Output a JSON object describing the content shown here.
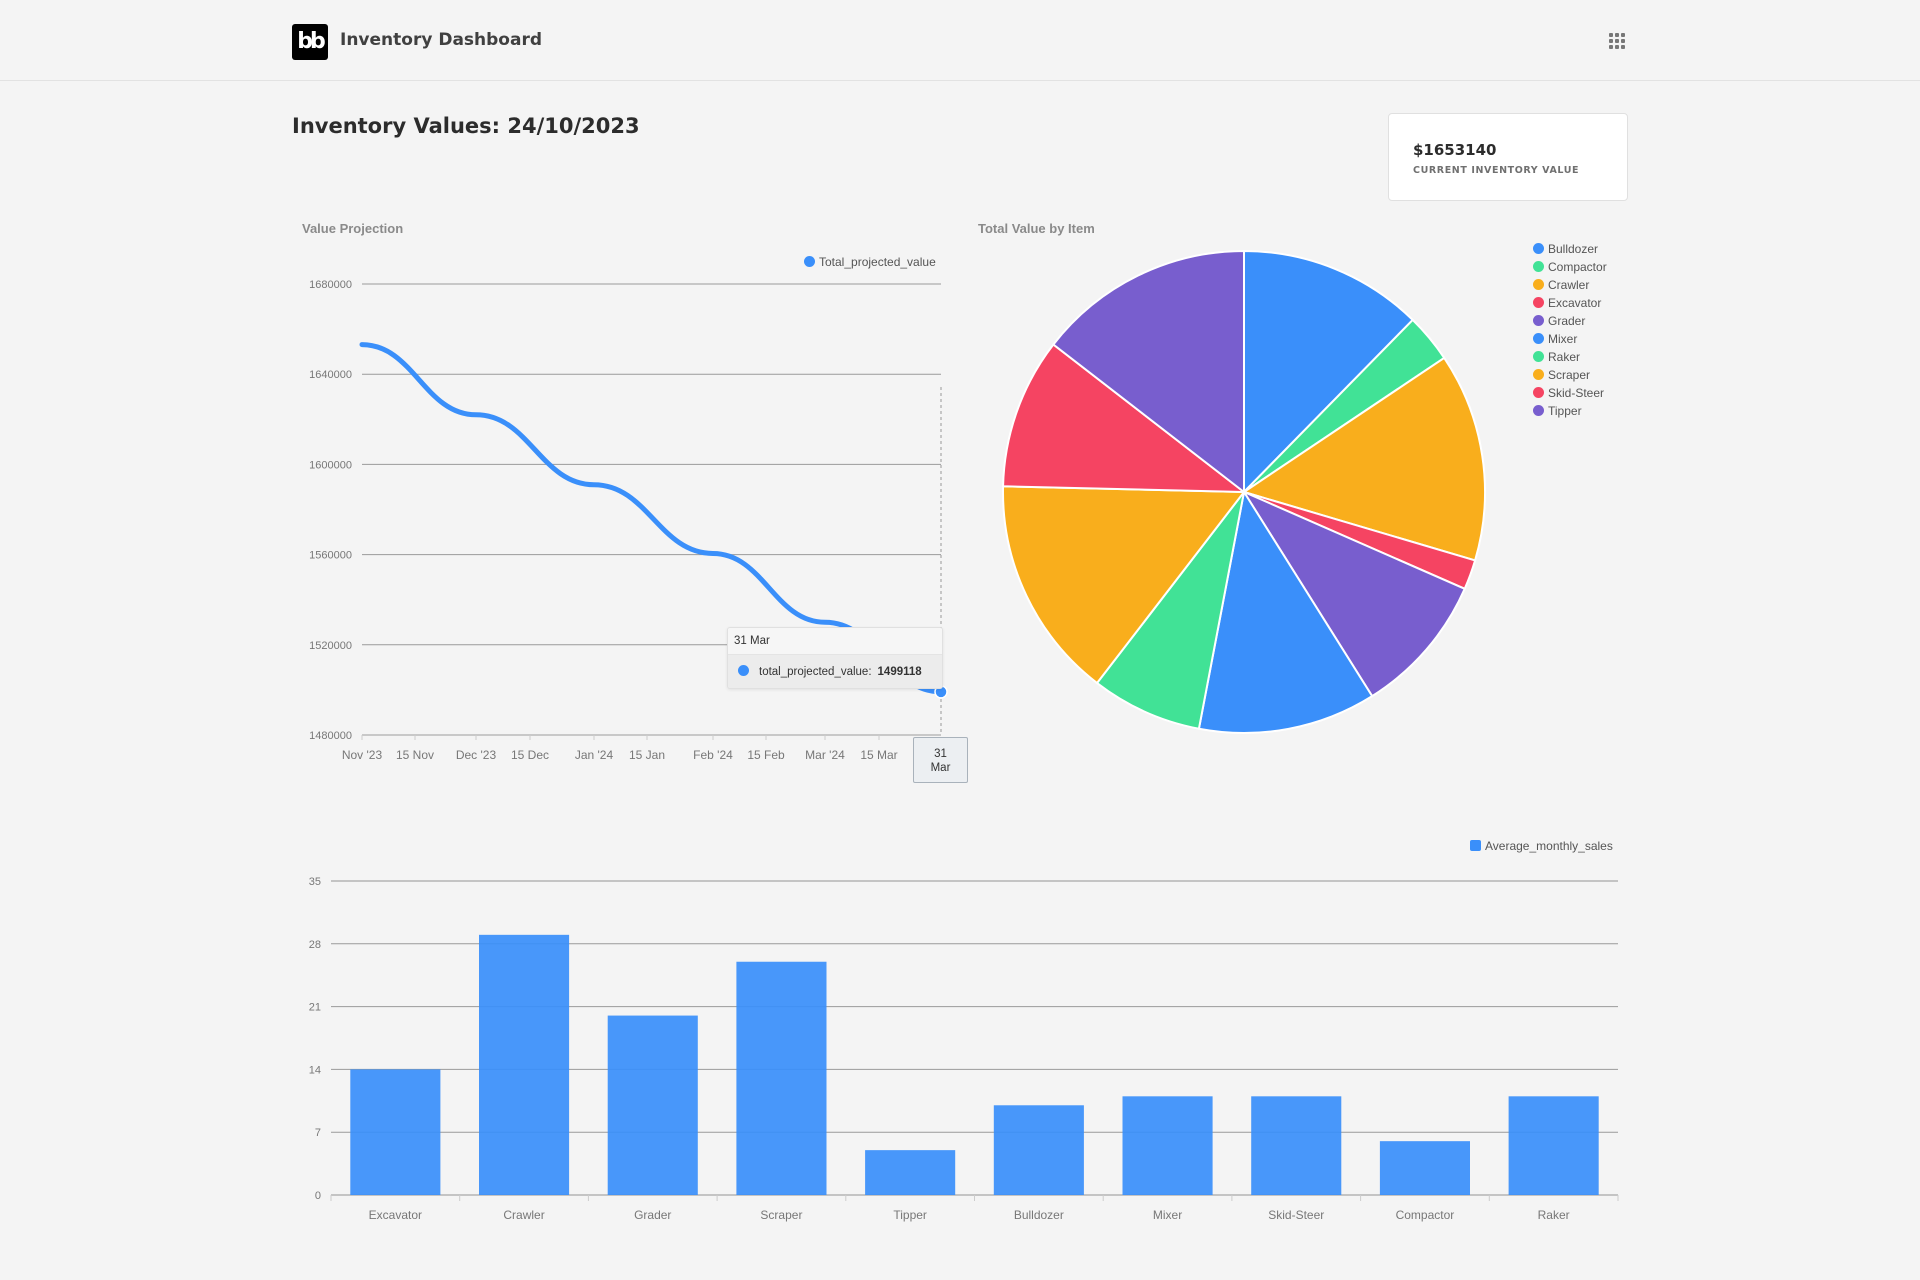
{
  "header": {
    "logo_text": "bb",
    "app_title": "Inventory Dashboard",
    "apps_icon": "grid-icon"
  },
  "page": {
    "title": "Inventory Values: 24/10/2023"
  },
  "kpi": {
    "value": "$1653140",
    "label": "CURRENT INVENTORY VALUE"
  },
  "colors": {
    "blue": "#3a8ffa",
    "green": "#41e296",
    "orange": "#f9ae1c",
    "red": "#f54462",
    "purple": "#785ece",
    "bar": "#449dfb"
  },
  "chart_data": [
    {
      "type": "line",
      "title": "Value Projection",
      "series": [
        {
          "name": "Total_projected_value",
          "x": [
            "Nov '23",
            "Dec '23",
            "Jan '24",
            "Feb '24",
            "Mar '24",
            "31 Mar"
          ],
          "values": [
            1653140,
            1622000,
            1591000,
            1560500,
            1530000,
            1499118
          ]
        }
      ],
      "x_ticks": [
        "Nov '23",
        "15 Nov",
        "Dec '23",
        "15 Dec",
        "Jan '24",
        "15 Jan",
        "Feb '24",
        "15 Feb",
        "Mar '24",
        "15 Mar"
      ],
      "y_ticks": [
        "1680000",
        "1640000",
        "1600000",
        "1560000",
        "1520000",
        "1480000"
      ],
      "ylim": [
        1480000,
        1680000
      ],
      "grid": true,
      "legend": "top-right",
      "tooltip": {
        "title": "31 Mar",
        "series_label": "total_projected_value:",
        "value": "1499118"
      },
      "x_crosshair_label": "31 Mar"
    },
    {
      "type": "pie",
      "title": "Total Value by Item",
      "categories": [
        "Bulldozer",
        "Compactor",
        "Crawler",
        "Excavator",
        "Grader",
        "Mixer",
        "Raker",
        "Scraper",
        "Skid-Steer",
        "Tipper"
      ],
      "values": [
        204000,
        54000,
        231000,
        33000,
        157000,
        197000,
        123000,
        247000,
        167000,
        240000
      ],
      "colors": [
        "#3a8ffa",
        "#41e296",
        "#f9ae1c",
        "#f54462",
        "#785ece",
        "#3a8ffa",
        "#41e296",
        "#f9ae1c",
        "#f54462",
        "#785ece"
      ],
      "legend": "right"
    },
    {
      "type": "bar",
      "title": "",
      "categories": [
        "Excavator",
        "Crawler",
        "Grader",
        "Scraper",
        "Tipper",
        "Bulldozer",
        "Mixer",
        "Skid-Steer",
        "Compactor",
        "Raker"
      ],
      "series": [
        {
          "name": "Average_monthly_sales",
          "values": [
            14,
            29,
            20,
            26,
            5,
            10,
            11,
            11,
            6,
            11
          ]
        }
      ],
      "y_ticks": [
        "0",
        "7",
        "14",
        "21",
        "28",
        "35"
      ],
      "ylim": [
        0,
        35
      ],
      "grid": true,
      "legend": "top-right"
    }
  ]
}
